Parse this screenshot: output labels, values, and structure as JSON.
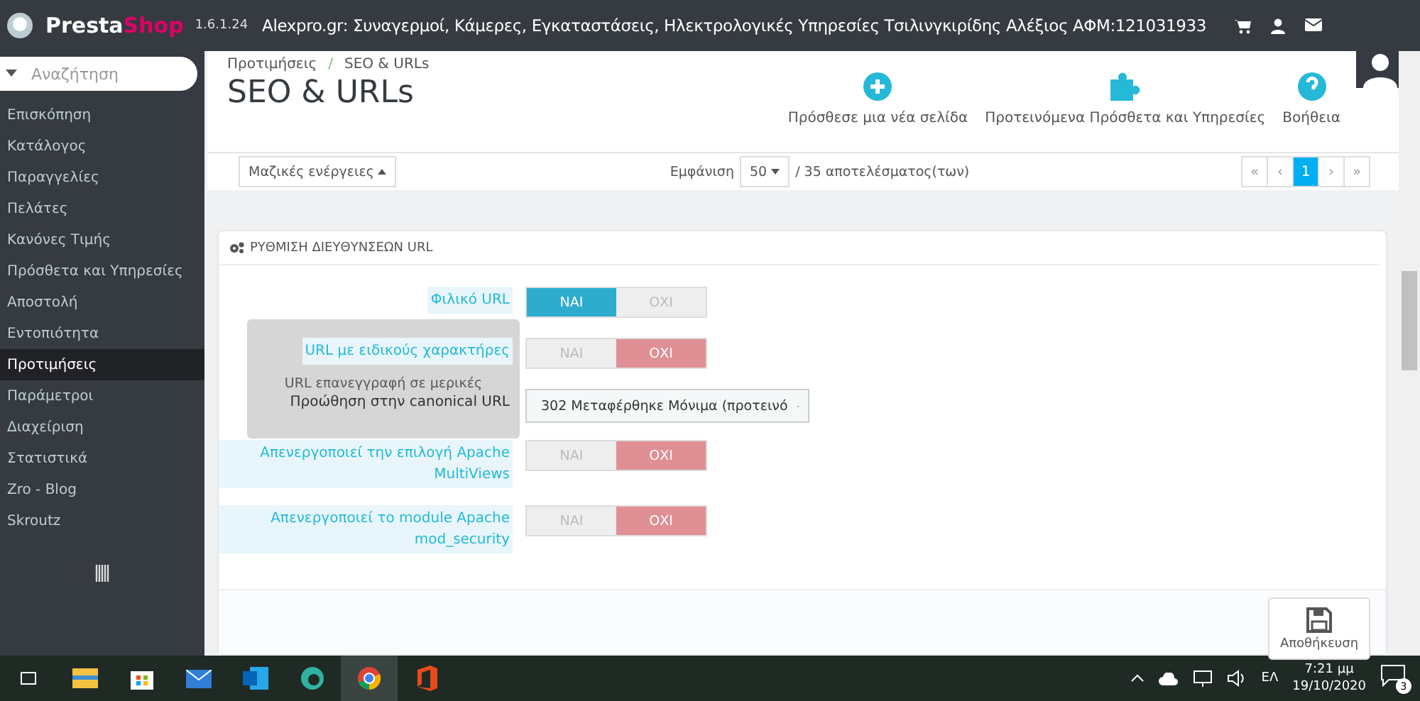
{
  "topbar": {
    "brand_first": "Presta",
    "brand_second": "Shop",
    "version": "1.6.1.24",
    "shop_name": "Alexpro.gr: Συναγερμοί, Κάμερες, Εγκαταστάσεις, Ηλεκτρολογικές Υπηρεσίες Τσιλινγκιρίδης Αλέξιος ΑΦΜ:121031933"
  },
  "sidebar": {
    "search": {
      "placeholder": "Αναζήτηση"
    },
    "items": [
      {
        "label": "Επισκόπηση",
        "selected": false
      },
      {
        "label": "Κατάλογος",
        "selected": false
      },
      {
        "label": "Παραγγελίες",
        "selected": false
      },
      {
        "label": "Πελάτες",
        "selected": false
      },
      {
        "label": "Κανόνες Τιμής",
        "selected": false
      },
      {
        "label": "Πρόσθετα και Υπηρεσίες",
        "selected": false
      },
      {
        "label": "Αποστολή",
        "selected": false
      },
      {
        "label": "Εντοπιότητα",
        "selected": false
      },
      {
        "label": "Προτιμήσεις",
        "selected": true
      },
      {
        "label": "Παράμετροι",
        "selected": false
      },
      {
        "label": "Διαχείριση",
        "selected": false
      },
      {
        "label": "Στατιστικά",
        "selected": false
      },
      {
        "label": "Zro - Blog",
        "selected": false
      },
      {
        "label": "Skroutz",
        "selected": false
      }
    ]
  },
  "header": {
    "breadcrumb": [
      "Προτιμήσεις",
      "SEO & URLs"
    ],
    "separator": "/",
    "title": "SEO & URLs",
    "toolbar": [
      {
        "kind": "add",
        "label": "Πρόσθεσε μια νέα σελίδα"
      },
      {
        "kind": "modules",
        "label": "Προτεινόμενα Πρόσθετα και Υπηρεσίες"
      },
      {
        "kind": "help",
        "label": "Βοήθεια"
      }
    ]
  },
  "list_bar": {
    "bulk_actions": "Μαζικές ενέργειες",
    "show_label": "Εμφάνιση",
    "per_page": "50",
    "total": "/ 35 αποτελέσματος(των)",
    "pages": [
      {
        "label": "«",
        "selected": false
      },
      {
        "label": "‹",
        "selected": false
      },
      {
        "label": "1",
        "selected": true
      },
      {
        "label": "›",
        "selected": false
      },
      {
        "label": "»",
        "selected": false
      }
    ]
  },
  "panel": {
    "title": "ΡΥΘΜΙΣΗ ΔΙΕΥΘΥΝΣΕΩΝ URL",
    "fields": [
      {
        "kind": "switch",
        "label": "Φιλικό URL",
        "hint": true,
        "yes": "ΝΑΙ",
        "no": "ΟΧΙ",
        "on": true
      },
      {
        "kind": "switch",
        "label": "URL με ειδικούς χαρακτήρες",
        "hint": true,
        "yes": "ΝΑΙ",
        "no": "ΟΧΙ",
        "on": false
      },
      {
        "kind": "select",
        "label": "Προώθηση στην canonical URL",
        "hint": false,
        "value": "302 Μεταφέρθηκε Μόνιμα (προτεινό"
      },
      {
        "kind": "switch",
        "label": "Απενεργοποιεί την επιλογή Apache MultiViews",
        "hint": true,
        "yes": "ΝΑΙ",
        "no": "ΟΧΙ",
        "on": false
      },
      {
        "kind": "switch",
        "label": "Απενεργοποιεί το module Apache mod_security",
        "hint": true,
        "yes": "ΝΑΙ",
        "no": "ΟΧΙ",
        "on": false
      }
    ],
    "tooltip": "URL επανεγγραφή σε μερικές",
    "save": "Αποθήκευση"
  },
  "taskbar": {
    "language": "ΕΛ",
    "time": "7:21 μμ",
    "date": "19/10/2020",
    "notifications": "3"
  }
}
